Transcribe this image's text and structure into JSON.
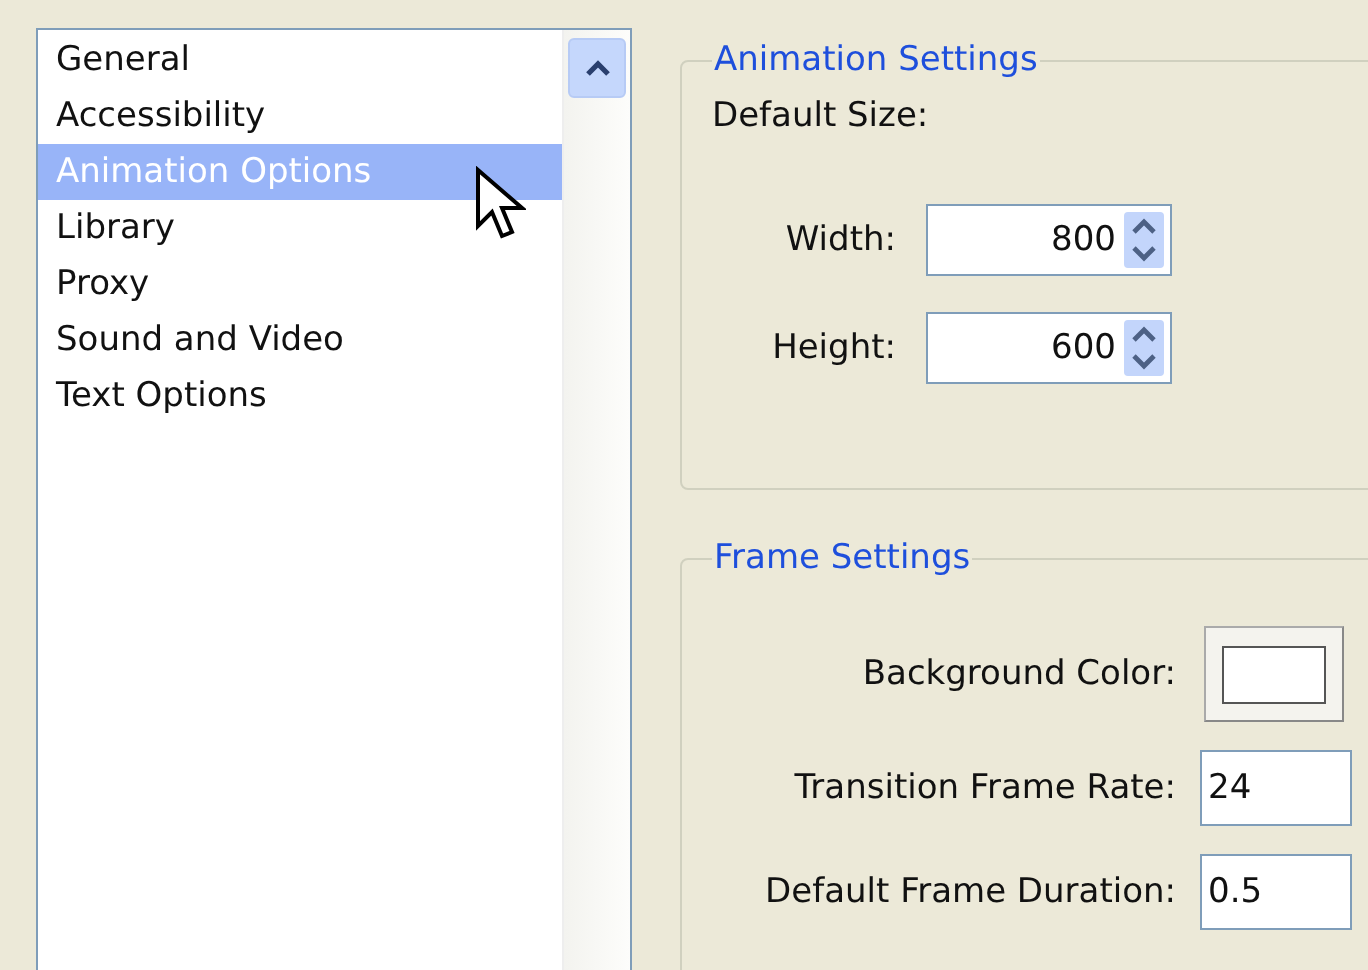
{
  "sidebar": {
    "items": [
      {
        "label": "General",
        "selected": false
      },
      {
        "label": "Accessibility",
        "selected": false
      },
      {
        "label": "Animation Options",
        "selected": true
      },
      {
        "label": "Library",
        "selected": false
      },
      {
        "label": "Proxy",
        "selected": false
      },
      {
        "label": "Sound and Video",
        "selected": false
      },
      {
        "label": "Text Options",
        "selected": false
      }
    ]
  },
  "animation_settings": {
    "title": "Animation Settings",
    "default_size_label": "Default Size:",
    "fields": [
      {
        "label": "Width:",
        "value": "800"
      },
      {
        "label": "Height:",
        "value": "600"
      }
    ]
  },
  "frame_settings": {
    "title": "Frame Settings",
    "rows": [
      {
        "kind": "color",
        "label": "Background Color:"
      },
      {
        "kind": "text",
        "label": "Transition Frame Rate:",
        "value": "24"
      },
      {
        "kind": "text",
        "label": "Default Frame Duration:",
        "value": "0.5"
      }
    ]
  }
}
